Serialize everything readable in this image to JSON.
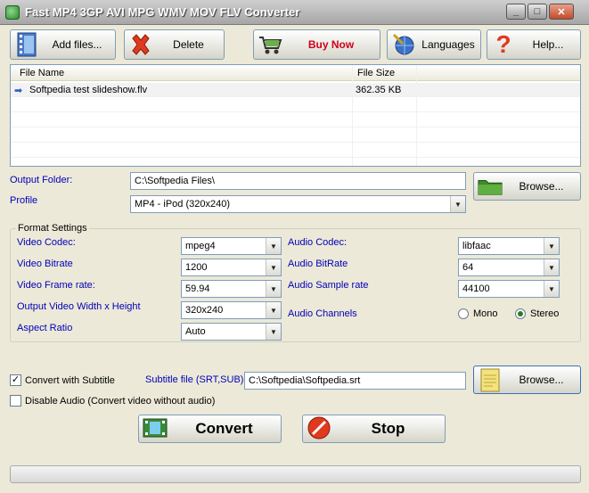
{
  "window": {
    "title": "Fast MP4 3GP AVI MPG WMV MOV FLV Converter"
  },
  "toolbar": {
    "add_files": "Add files...",
    "delete": "Delete",
    "buy_now": "Buy Now",
    "languages": "Languages",
    "help": "Help..."
  },
  "file_list": {
    "columns": [
      "File Name",
      "File Size"
    ],
    "rows": [
      {
        "name": "Softpedia test slideshow.flv",
        "size": "362.35 KB"
      }
    ]
  },
  "output_folder": {
    "label": "Output Folder:",
    "value": "C:\\Softpedia Files\\",
    "browse": "Browse..."
  },
  "profile": {
    "label": "Profile",
    "value": "MP4 - iPod (320x240)"
  },
  "format_settings": {
    "title": "Format Settings",
    "video_codec": {
      "label": "Video Codec:",
      "value": "mpeg4"
    },
    "video_bitrate": {
      "label": "Video Bitrate",
      "value": "1200"
    },
    "video_frame_rate": {
      "label": "Video Frame rate:",
      "value": "59.94"
    },
    "output_size": {
      "label": "Output Video Width x Height",
      "value": "320x240"
    },
    "aspect_ratio": {
      "label": "Aspect Ratio",
      "value": "Auto"
    },
    "audio_codec": {
      "label": "Audio Codec:",
      "value": "libfaac"
    },
    "audio_bitrate": {
      "label": "Audio BitRate",
      "value": "64"
    },
    "audio_sample_rate": {
      "label": "Audio Sample rate",
      "value": "44100"
    },
    "audio_channels": {
      "label": "Audio Channels",
      "mono": "Mono",
      "stereo": "Stereo",
      "selected": "Stereo"
    }
  },
  "subtitle": {
    "checkbox_label": "Convert with Subtitle",
    "checked": true,
    "file_label": "Subtitle file (SRT,SUB)",
    "value": "C:\\Softpedia\\Softpedia.srt",
    "browse": "Browse..."
  },
  "disable_audio": {
    "label": "Disable Audio (Convert video without audio)",
    "checked": false
  },
  "actions": {
    "convert": "Convert",
    "stop": "Stop"
  },
  "icons": {
    "app": "app-icon",
    "add": "film-add-icon",
    "delete": "red-x-icon",
    "buy": "cart-icon",
    "languages": "pen-globe-icon",
    "help": "question-icon",
    "folder": "folder-icon",
    "subtitle_file": "notepad-icon",
    "convert": "film-icon",
    "stop": "stop-icon",
    "row": "arrow-right-icon"
  }
}
